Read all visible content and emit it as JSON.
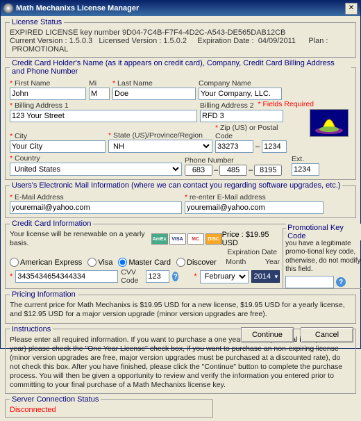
{
  "window": {
    "title": "Math Mechanixs License Manager",
    "close": "✕"
  },
  "license_status": {
    "legend": "License Status",
    "line1": "EXPIRED LICENSE key number 9D04-7C4B-F7F4-4D2C-A543-DE565DAB12CB",
    "cur_v_lbl": "Current Version :",
    "cur_v": "1.5.0.3",
    "lic_v_lbl": "Licensed Version :",
    "lic_v": "1.5.0.2",
    "exp_lbl": "Expiration Date :",
    "exp": "04/09/2011",
    "plan_lbl": "Plan :",
    "plan": "PROMOTIONAL"
  },
  "holder": {
    "legend": "Credit Card Holder's Name (as it appears on credit card), Company, Credit Card Billing Address and Phone Number",
    "first_lbl": "First Name",
    "first": "John",
    "mi_lbl": "Mi",
    "mi": "M",
    "last_lbl": "Last Name",
    "last": "Doe",
    "company_lbl": "Company Name",
    "company": "Your Company, LLC.",
    "addr1_lbl": "Billing Address 1",
    "addr1": "123 Your Street",
    "addr2_lbl": "Billing Address 2",
    "addr2": "RFD 3",
    "city_lbl": "City",
    "city": "Your City",
    "state_lbl": "State (US)/Province/Region",
    "state": "NH",
    "zip_lbl": "Zip (US) or Postal Code",
    "zip": "33273",
    "zip2": "1234",
    "country_lbl": "Country",
    "country": "United States",
    "phone_lbl": "Phone Number",
    "ext_lbl": "Ext.",
    "ph1": "683",
    "ph2": "485",
    "ph3": "8195",
    "ext": "1234",
    "required": "*  Fields Required"
  },
  "email": {
    "legend": "Users's Electronic Mail Information (where we can contact you regarding software upgrades, etc.)",
    "e1_lbl": "E-Mail Address",
    "e1": "youremail@yahoo.com",
    "e2_lbl": "re-enter E-Mail address",
    "e2": "youremail@yahoo.com"
  },
  "cc": {
    "legend": "Credit Card Information",
    "renewal_txt": "Your license will be renewable on a yearly basis.",
    "r_amex": "American Express",
    "r_visa": "Visa",
    "r_mc": "Master Card",
    "r_disc": "Discover",
    "num": "3435434654344334",
    "cvv_lbl": "CVV Code",
    "cvv": "123",
    "price_lbl": "Price :",
    "price": "$19.95 USD",
    "expd_lbl": "Expiration Date",
    "month_lbl": "Month",
    "month": "February",
    "year_lbl": "Year",
    "year": "2014",
    "promo_legend": "Promotional Key Code",
    "promo_txt": "Use this field ONLY if you have a legitimate promo-tional key code, otherwise, do not modify this field."
  },
  "pricing": {
    "legend": "Pricing Information",
    "text": "The current price for Math Mechanixs is $19.95 USD for a new license, $19.95 USD for a yearly license, and $12.95 USD for a major version upgrade (minor version upgrades are free)."
  },
  "instructions": {
    "legend": "Instructions",
    "text": "Please enter all required information. If you want to purchase a one year license (renewal is required next year) please check the \"One Year License\" check box, if you want to purchase an non-expiring license (minor version upgrades are free, major version upgrades must be purchased at a discounted rate), do not check this box. After you have finished, please click the \"Continue\" button to complete the purchase process.  You will then be given a opportunity to review and verify the information you entered prior to committing to your final purchase of a Math Mechanixs license key."
  },
  "server": {
    "legend": "Server Connection Status",
    "status": "Disconnected"
  },
  "buttons": {
    "continue": "Continue",
    "cancel": "Cancel"
  }
}
